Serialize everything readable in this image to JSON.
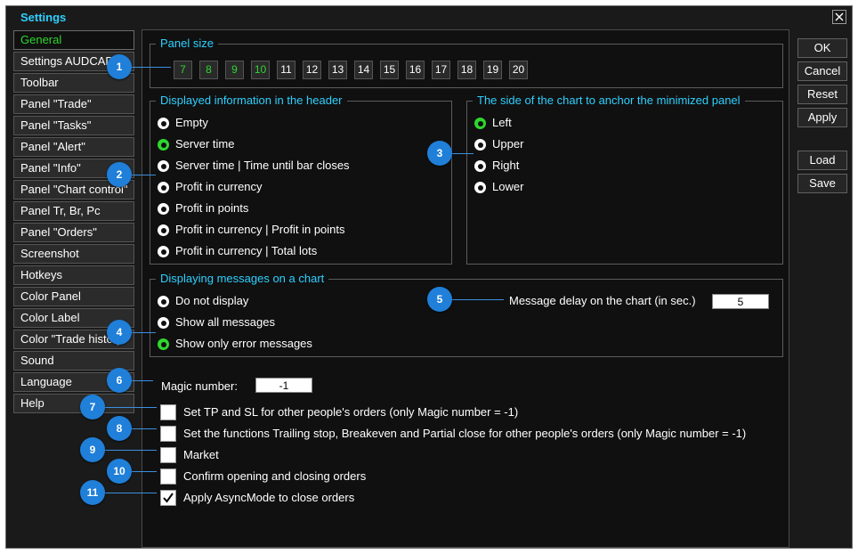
{
  "window": {
    "title": "Settings"
  },
  "sidebar": {
    "items": [
      {
        "label": "General",
        "active": true
      },
      {
        "label": "Settings AUDCAD"
      },
      {
        "label": "Toolbar"
      },
      {
        "label": "Panel \"Trade\""
      },
      {
        "label": "Panel \"Tasks\""
      },
      {
        "label": "Panel \"Alert\""
      },
      {
        "label": "Panel \"Info\""
      },
      {
        "label": "Panel \"Chart control\""
      },
      {
        "label": "Panel Tr, Br, Pc"
      },
      {
        "label": "Panel \"Orders\""
      },
      {
        "label": "Screenshot"
      },
      {
        "label": "Hotkeys"
      },
      {
        "label": "Color Panel"
      },
      {
        "label": "Color Label"
      },
      {
        "label": "Color \"Trade history\""
      },
      {
        "label": "Sound"
      },
      {
        "label": "Language"
      },
      {
        "label": "Help"
      }
    ]
  },
  "panel_size": {
    "title": "Panel size",
    "options": [
      "7",
      "8",
      "9",
      "10",
      "11",
      "12",
      "13",
      "14",
      "15",
      "16",
      "17",
      "18",
      "19",
      "20"
    ],
    "highlighted": [
      "7",
      "8",
      "9",
      "10"
    ]
  },
  "header_info": {
    "title": "Displayed information in the header",
    "options": [
      "Empty",
      "Server time",
      "Server time | Time until bar closes",
      "Profit in currency",
      "Profit in points",
      "Profit in currency | Profit in points",
      "Profit in currency | Total lots"
    ],
    "selected": "Server time"
  },
  "anchor_side": {
    "title": "The side of the chart to anchor the minimized panel",
    "options": [
      "Left",
      "Upper",
      "Right",
      "Lower"
    ],
    "selected": "Left"
  },
  "messages": {
    "title": "Displaying messages on a chart",
    "options": [
      "Do not display",
      "Show all messages",
      "Show only error messages"
    ],
    "selected": "Show only error messages",
    "delay_label": "Message delay on the chart (in sec.)",
    "delay_value": "5"
  },
  "magic": {
    "label": "Magic number:",
    "value": "-1"
  },
  "checkboxes": [
    {
      "label": "Set TP and SL for other people's orders (only Magic number = -1)",
      "checked": false
    },
    {
      "label": "Set the functions Trailing stop, Breakeven and Partial close for other people's orders (only Magic number = -1)",
      "checked": false
    },
    {
      "label": "Market",
      "checked": false
    },
    {
      "label": "Confirm opening and closing orders",
      "checked": false
    },
    {
      "label": "Apply AsyncMode to close orders",
      "checked": true
    }
  ],
  "buttons": {
    "ok": "OK",
    "cancel": "Cancel",
    "reset": "Reset",
    "apply": "Apply",
    "load": "Load",
    "save": "Save"
  },
  "callouts": [
    "1",
    "2",
    "3",
    "4",
    "5",
    "6",
    "7",
    "8",
    "9",
    "10",
    "11"
  ],
  "colors": {
    "accent_title": "#2ed0ff",
    "active_green": "#2fd62f",
    "callout_blue": "#1f7fd9",
    "background": "#101010"
  }
}
